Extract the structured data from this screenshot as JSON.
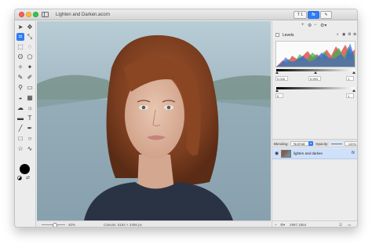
{
  "window": {
    "title": "Lighten and Darken.acorn",
    "toolbar_tabs": [
      {
        "label": "T 1",
        "icon": "layers-icon"
      },
      {
        "label": "fx",
        "icon": "effects-icon"
      },
      {
        "label": "✎",
        "icon": "brush-icon"
      }
    ]
  },
  "tools": [
    "arrow-tool",
    "text-arrow-tool",
    "crop-tool",
    "transform-tool",
    "rect-select-tool",
    "ellipse-select-tool",
    "lasso-tool",
    "polygon-lasso-tool",
    "magic-wand-tool",
    "color-select-tool",
    "brush-tool",
    "pencil-tool",
    "clone-tool",
    "eraser-tool",
    "paint-bucket-tool",
    "gradient-tool",
    "dodge-tool",
    "burn-tool",
    "shape-tool",
    "text-tool",
    "line-tool",
    "pen-tool",
    "rect-tool",
    "oval-tool",
    "star-tool",
    "bezier-tool"
  ],
  "status": {
    "zoom": "40%",
    "canvas_info": "Canvas: 5184 × 3456 px"
  },
  "filters": {
    "levels": {
      "label": "Levels",
      "input_black": "0.026",
      "input_gamma": "0.993",
      "input_white": "1",
      "output_black": "0",
      "output_white": "1"
    }
  },
  "layers": {
    "blending_label": "Blending:",
    "blending_mode": "Normal",
    "opacity_label": "Opacity:",
    "opacity_value": "100%",
    "items": [
      {
        "name": "lighten and darken",
        "fx": "fx"
      }
    ]
  },
  "footer": {
    "coords": "2997,1854"
  }
}
